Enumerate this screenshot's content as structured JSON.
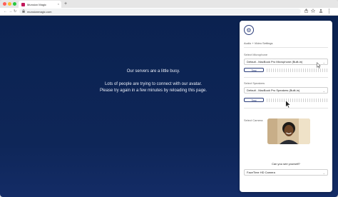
{
  "browser": {
    "tab_title": "Munsion Magic",
    "tab_close": "×",
    "new_tab": "+",
    "nav_back": "←",
    "nav_forward": "→",
    "nav_reload": "↻",
    "lock": "🔒",
    "url": "munsionmagic.com"
  },
  "message": {
    "line1": "Our servers are a little busy.",
    "line2": "Lots of people are trying to connect with our avatar.",
    "line3": "Please try again in a few minutes by reloading this page."
  },
  "panel": {
    "title": "Audio + Video Settings",
    "microphone_label": "Select Microphone",
    "microphone_value": "Default - MacBook Pro Microphone (Built-in)",
    "speakers_label": "Select Speakers",
    "speakers_value": "Default - MacBook Pro Speakers (Built-in)",
    "test_label": "Test",
    "camera_label": "Select Camera",
    "camera_question": "Can you see yourself?",
    "camera_value": "FaceTime HD Camera"
  },
  "icons": {
    "gear": "⚙",
    "chevron": "⌄"
  },
  "colors": {
    "accent": "#2b3d7a",
    "page_bg": "#0b2250"
  }
}
